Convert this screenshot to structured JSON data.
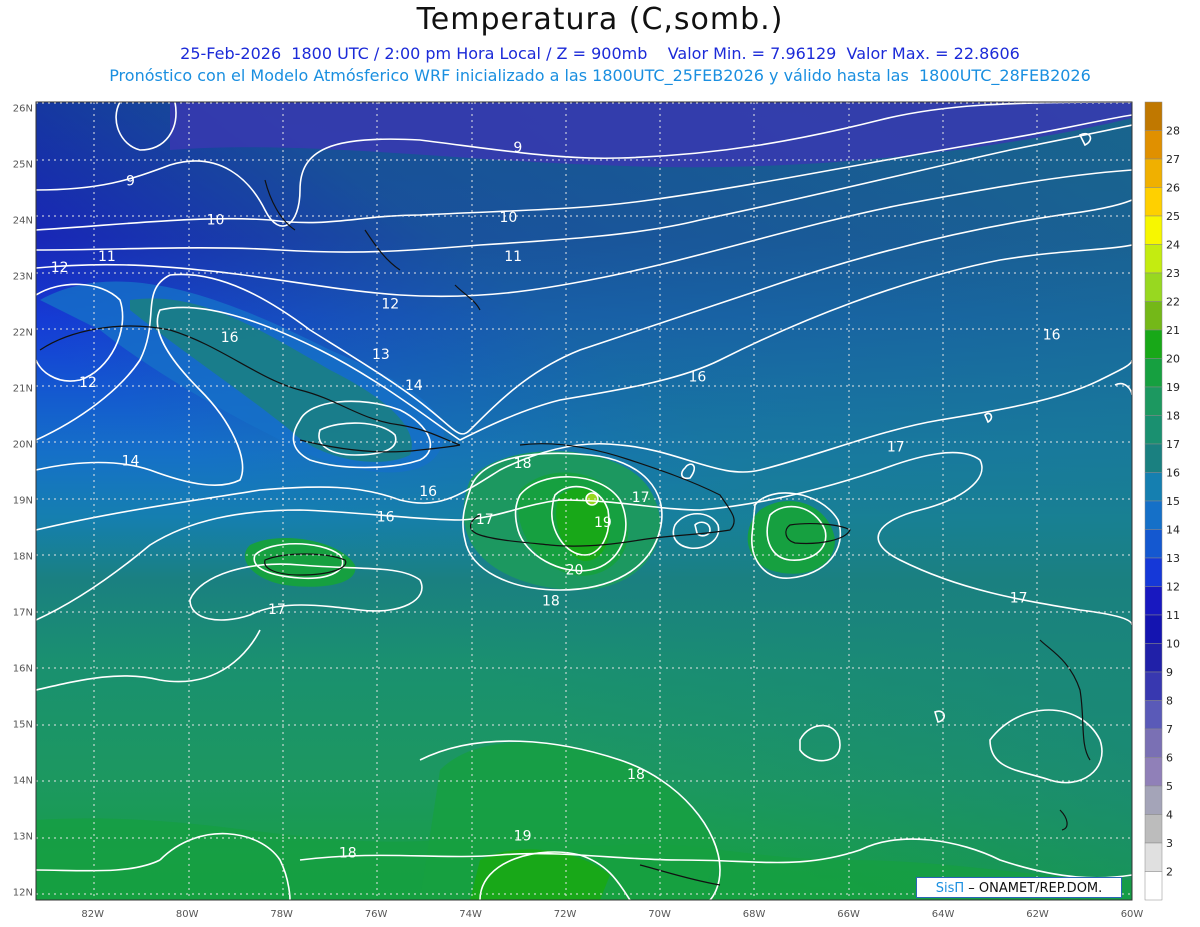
{
  "title": "Temperatura (C,somb.)",
  "subtitle1": "25-Feb-2026  1800 UTC / 2:00 pm Hora Local / Z = 900mb    Valor Min. = 7.96129  Valor Max. = 22.8606",
  "subtitle2": "Pronóstico con el Modelo Atmósferico WRF inicializado a las 1800UTC_25FEB2026 y válido hasta las  1800UTC_28FEB2026",
  "credit": {
    "logo": "SisΠ",
    "text": " – ONAMET/REP.DOM."
  },
  "axes": {
    "lat_labels": [
      "26N",
      "25N",
      "24N",
      "23N",
      "22N",
      "21N",
      "20N",
      "19N",
      "18N",
      "17N",
      "16N",
      "15N",
      "14N",
      "13N",
      "12N"
    ],
    "lon_labels": [
      "82W",
      "80W",
      "78W",
      "76W",
      "74W",
      "72W",
      "70W",
      "68W",
      "66W",
      "64W",
      "62W",
      "60W"
    ]
  },
  "colorbar": {
    "labels": [
      "28",
      "27",
      "26",
      "25",
      "24",
      "23",
      "22",
      "21",
      "20",
      "19",
      "18",
      "17",
      "16",
      "15",
      "14",
      "13",
      "12",
      "11",
      "10",
      "9",
      "8",
      "7",
      "6",
      "5",
      "4",
      "3",
      "2"
    ],
    "colors": [
      "#c07800",
      "#e09000",
      "#f0b000",
      "#ffd000",
      "#f7f700",
      "#c4ec10",
      "#98d820",
      "#74b818",
      "#18a818",
      "#16a040",
      "#1c9860",
      "#1a9070",
      "#1a8080",
      "#157fb0",
      "#1570c8",
      "#1458d0",
      "#1538d8",
      "#1818c0",
      "#1414b0",
      "#2020a8",
      "#3838b0",
      "#5a5ab8",
      "#7a70b4",
      "#9080b8",
      "#a4a4b8",
      "#bcbcbc",
      "#e0e0e0",
      "#ffffff"
    ]
  },
  "map_data": {
    "extent": {
      "lon_min": -83.2,
      "lon_max": -60.0,
      "lat_min": 11.85,
      "lat_max": 26.1
    },
    "field_min": 7.96129,
    "field_max": 22.8606,
    "contour_labels": [
      {
        "text": "9",
        "lon": -81.2,
        "lat": 24.7
      },
      {
        "text": "9",
        "lon": -73.0,
        "lat": 25.3
      },
      {
        "text": "10",
        "lon": -79.4,
        "lat": 24.0
      },
      {
        "text": "10",
        "lon": -73.2,
        "lat": 24.05
      },
      {
        "text": "11",
        "lon": -81.7,
        "lat": 23.35
      },
      {
        "text": "11",
        "lon": -73.1,
        "lat": 23.35
      },
      {
        "text": "12",
        "lon": -82.7,
        "lat": 23.15
      },
      {
        "text": "12",
        "lon": -75.7,
        "lat": 22.5
      },
      {
        "text": "12",
        "lon": -82.1,
        "lat": 21.1
      },
      {
        "text": "13",
        "lon": -75.9,
        "lat": 21.6
      },
      {
        "text": "14",
        "lon": -75.2,
        "lat": 21.05
      },
      {
        "text": "14",
        "lon": -81.2,
        "lat": 19.7
      },
      {
        "text": "16",
        "lon": -79.1,
        "lat": 21.9
      },
      {
        "text": "16",
        "lon": -74.9,
        "lat": 19.15
      },
      {
        "text": "16",
        "lon": -75.8,
        "lat": 18.7
      },
      {
        "text": "16",
        "lon": -69.2,
        "lat": 21.2
      },
      {
        "text": "16",
        "lon": -61.7,
        "lat": 21.95
      },
      {
        "text": "17",
        "lon": -73.7,
        "lat": 18.65
      },
      {
        "text": "17",
        "lon": -70.4,
        "lat": 19.05
      },
      {
        "text": "17",
        "lon": -78.1,
        "lat": 17.05
      },
      {
        "text": "17",
        "lon": -65.0,
        "lat": 19.95
      },
      {
        "text": "17",
        "lon": -62.4,
        "lat": 17.25
      },
      {
        "text": "18",
        "lon": -72.9,
        "lat": 19.65
      },
      {
        "text": "18",
        "lon": -72.3,
        "lat": 17.2
      },
      {
        "text": "18",
        "lon": -70.5,
        "lat": 14.1
      },
      {
        "text": "18",
        "lon": -76.6,
        "lat": 12.7
      },
      {
        "text": "19",
        "lon": -71.2,
        "lat": 18.6
      },
      {
        "text": "19",
        "lon": -72.9,
        "lat": 13.0
      },
      {
        "text": "20",
        "lon": -71.8,
        "lat": 17.75
      }
    ]
  }
}
